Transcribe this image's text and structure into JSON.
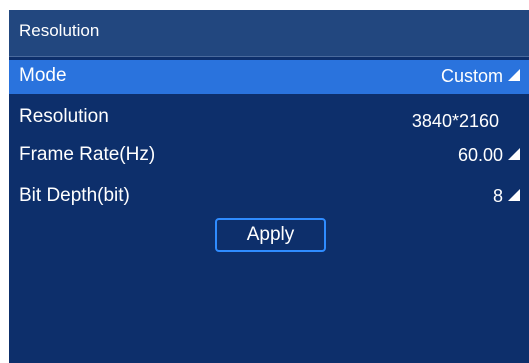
{
  "header": {
    "title": "Resolution"
  },
  "rows": [
    {
      "label": "Mode",
      "value": "Custom",
      "has_arrow": true,
      "selected": true
    },
    {
      "label": "Resolution",
      "value": "3840*2160",
      "has_arrow": false,
      "selected": false
    },
    {
      "label": "Frame Rate(Hz)",
      "value": "60.00",
      "has_arrow": true,
      "selected": false
    },
    {
      "label": "Bit Depth(bit)",
      "value": "8",
      "has_arrow": true,
      "selected": false
    }
  ],
  "apply_button": {
    "label": "Apply"
  },
  "colors": {
    "panel_background": "#0d2f6b",
    "header_background": "#22477f",
    "selected_row": "#2a73dd",
    "button_border": "#2f8cff",
    "text": "#ffffff"
  },
  "icons": {
    "dropdown_arrow": "triangle-dropdown-icon"
  }
}
